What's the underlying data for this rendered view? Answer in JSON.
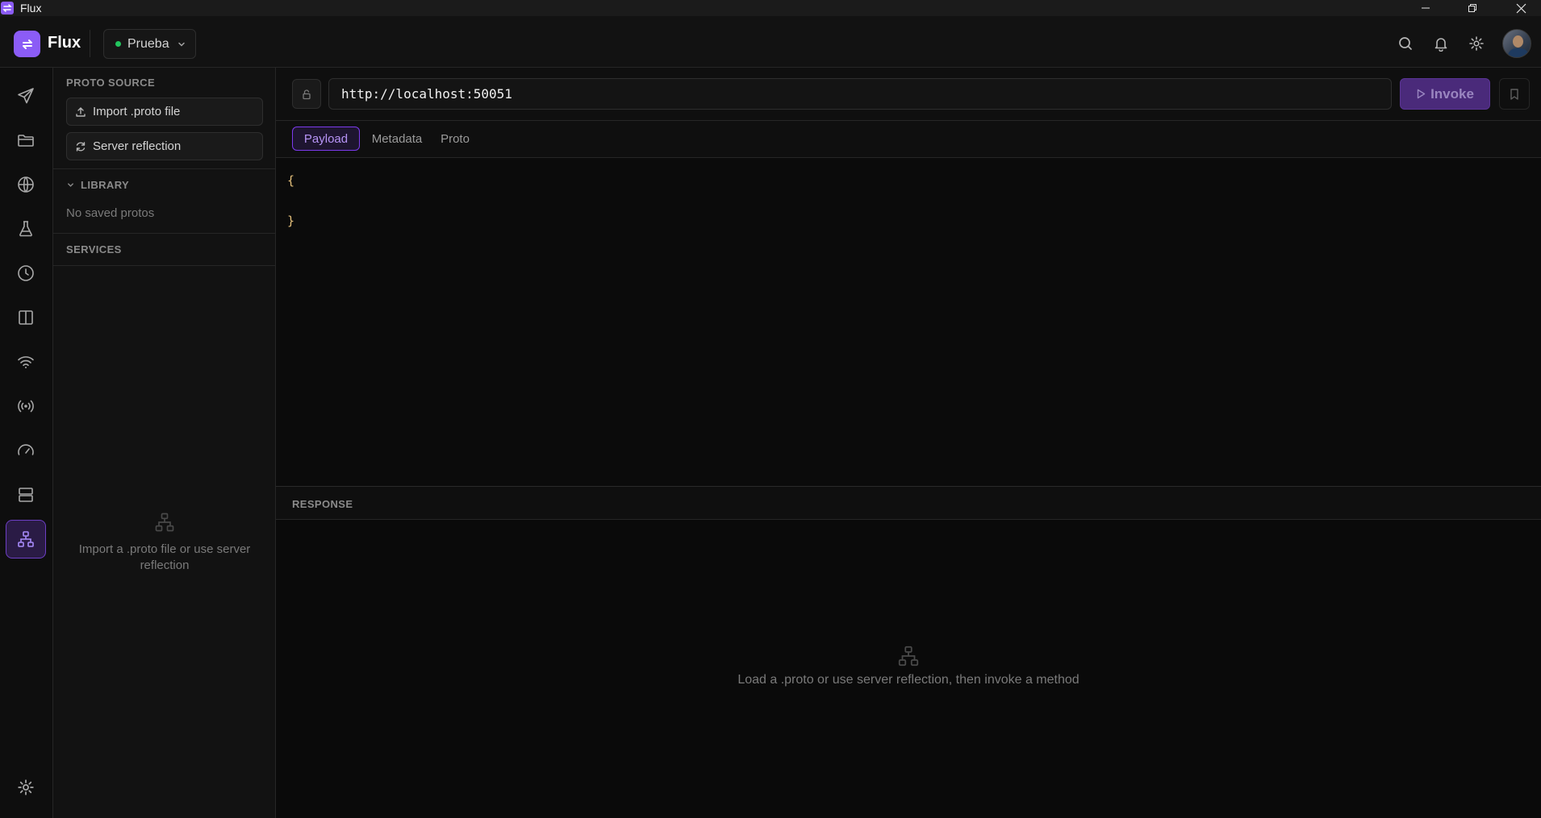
{
  "window": {
    "title": "Flux"
  },
  "header": {
    "app_name": "Flux",
    "environment": "Prueba",
    "icons": [
      "search-icon",
      "bell-icon",
      "gear-icon"
    ],
    "accent": "#8b5cf6",
    "env_status_color": "#22c55e"
  },
  "rail": {
    "items": [
      "send-icon",
      "folder-icon",
      "globe-icon",
      "flask-icon",
      "history-icon",
      "columns-icon",
      "wifi-icon",
      "broadcast-icon",
      "gauge-icon",
      "server-icon",
      "grpc-icon"
    ],
    "active": "grpc-icon",
    "bottom": "gear-icon"
  },
  "sidebar": {
    "proto_source_title": "PROTO SOURCE",
    "import_label": "Import .proto file",
    "reflection_label": "Server reflection",
    "library_title": "LIBRARY",
    "library_empty": "No saved protos",
    "services_title": "SERVICES",
    "services_empty": "Import a .proto file or use server reflection"
  },
  "request": {
    "url": "http://localhost:50051",
    "invoke_label": "Invoke",
    "tabs": [
      "Payload",
      "Metadata",
      "Proto"
    ],
    "active_tab": "Payload",
    "payload_lines": [
      "{",
      "",
      "}"
    ]
  },
  "response": {
    "title": "RESPONSE",
    "empty": "Load a .proto or use server reflection, then invoke a method"
  }
}
